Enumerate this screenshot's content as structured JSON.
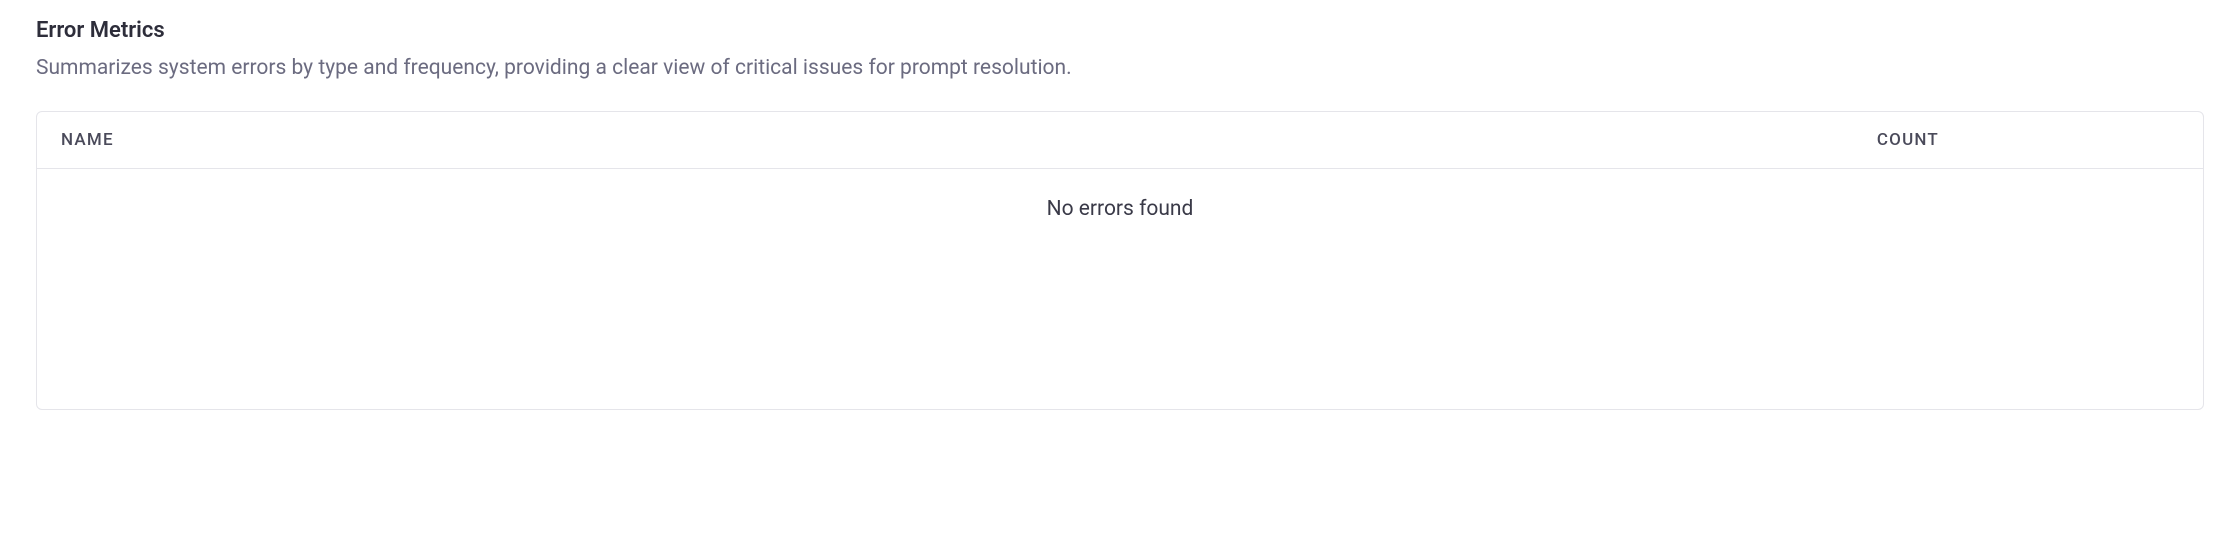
{
  "section": {
    "title": "Error Metrics",
    "description": "Summarizes system errors by type and frequency, providing a clear view of critical issues for prompt resolution."
  },
  "table": {
    "columns": {
      "name": "NAME",
      "count": "COUNT"
    },
    "empty_message": "No errors found"
  }
}
